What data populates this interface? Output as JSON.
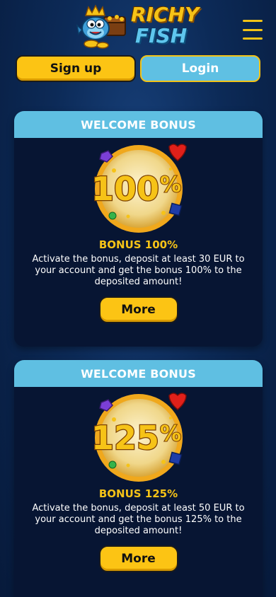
{
  "header": {
    "logo_line1": "RICHY",
    "logo_line2": "FISH"
  },
  "auth": {
    "signup_label": "Sign up",
    "login_label": "Login"
  },
  "bonuses": [
    {
      "header": "WELCOME BONUS",
      "coin_value": "100",
      "coin_unit": "%",
      "title": "BONUS 100%",
      "description": "Activate the bonus, deposit at least 30 EUR to your account and get the bonus 100% to the deposited amount!",
      "button_label": "More"
    },
    {
      "header": "WELCOME BONUS",
      "coin_value": "125",
      "coin_unit": "%",
      "title": "BONUS 125%",
      "description": "Activate the bonus, deposit at least 50 EUR to your account and get the bonus 125% to the deposited amount!",
      "button_label": "More"
    }
  ],
  "colors": {
    "accent_yellow": "#fcc414",
    "accent_blue": "#5fbfe2",
    "background": "#0c2a57",
    "card_background": "#071533"
  },
  "icons": {
    "menu": "hamburger-menu-icon",
    "logo": "fish-mascot-logo",
    "coin": "gold-bonus-coin-icon"
  }
}
